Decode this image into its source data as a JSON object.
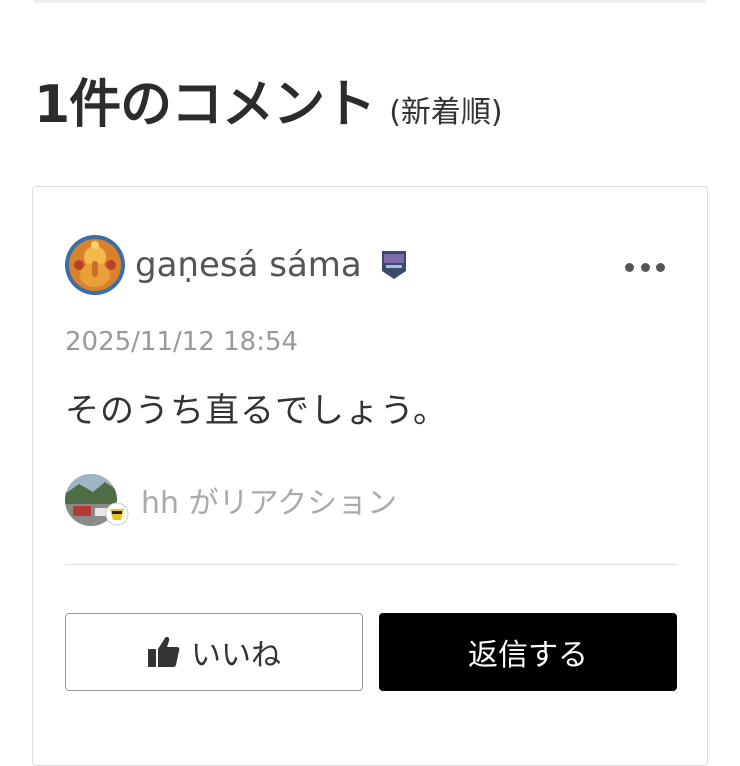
{
  "comments_header": {
    "title": "1件のコメント",
    "sort_label": "(新着順)"
  },
  "comment": {
    "author": "gaṇesá sáma",
    "timestamp": "2025/11/12 18:54",
    "body": "そのうち直るでしょう。",
    "reaction_text": "hh がリアクション",
    "like_label": "いいね",
    "reply_label": "返信する",
    "more_icon": "more-dots-icon"
  },
  "colors": {
    "reply_button_bg": "#000000",
    "muted_text": "#999999",
    "border": "#dcdcdc"
  }
}
